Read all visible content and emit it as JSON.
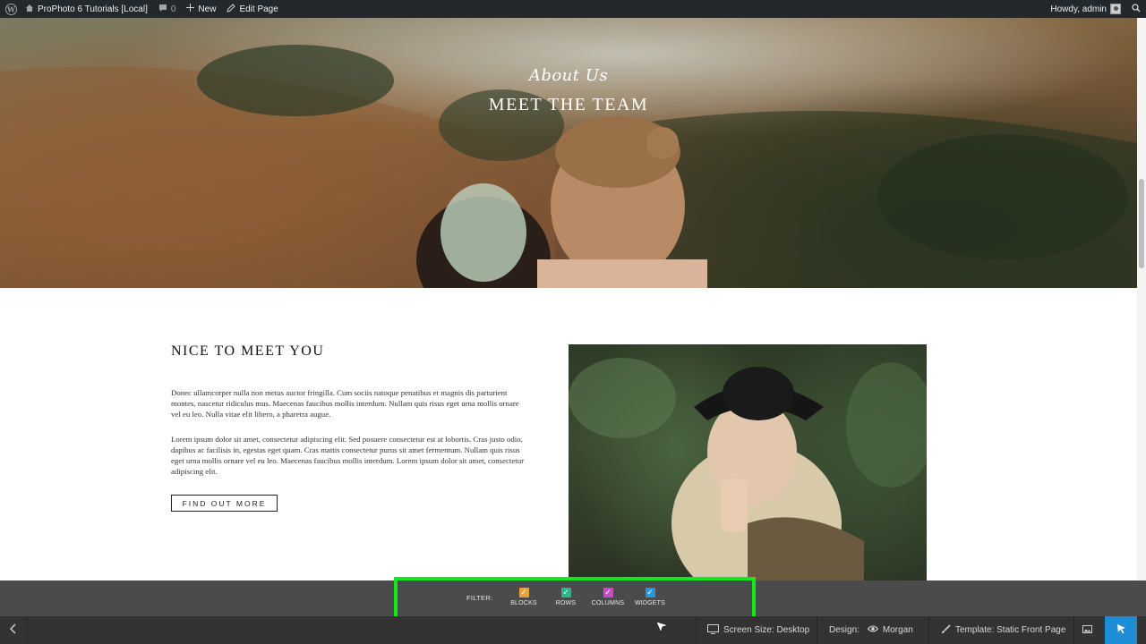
{
  "admin_bar": {
    "site_name": "ProPhoto 6 Tutorials [Local]",
    "comments_count": "0",
    "new_label": "New",
    "edit_label": "Edit Page",
    "howdy": "Howdy, admin"
  },
  "hero": {
    "script_title": "About Us",
    "title": "MEET THE TEAM"
  },
  "content": {
    "heading": "NICE TO MEET YOU",
    "para1": "Donec ullamcorper nulla non metus auctor fringilla. Cum sociis natoque penatibus et magnis dis parturient montes, nascetur ridiculus mus. Maecenas faucibus mollis interdum. Nullam quis risus eget urna mollis ornare vel eu leo. Nulla vitae elit libero, a pharetra augue.",
    "para2": "Lorem ipsum dolor sit amet, consectetur adipiscing elit. Sed posuere consectetur est at lobortis. Cras justo odio, dapibus ac facilisis in, egestas eget quam. Cras mattis consectetur purus sit amet fermentum. Nullam quis risus eget urna mollis ornare vel eu leo. Maecenas faucibus mollis interdum. Lorem ipsum dolor sit amet, consectetur adipiscing elit.",
    "button": "FIND OUT MORE"
  },
  "filter": {
    "label": "FILTER:",
    "options": [
      {
        "label": "BLOCKS",
        "color": "#e8a23a",
        "checked": true
      },
      {
        "label": "ROWS",
        "color": "#2bb58a",
        "checked": true
      },
      {
        "label": "COLUMNS",
        "color": "#c24fc2",
        "checked": true
      },
      {
        "label": "WIDGETS",
        "color": "#2b93d8",
        "checked": true
      }
    ]
  },
  "toolbar": {
    "screen_size": "Screen Size: Desktop",
    "design_label": "Design:",
    "design_value": "Morgan",
    "template": "Template: Static Front Page"
  },
  "colors": {
    "highlight": "#16e61a",
    "accent": "#1f8dd6",
    "admin_bar_bg": "#23282d"
  }
}
